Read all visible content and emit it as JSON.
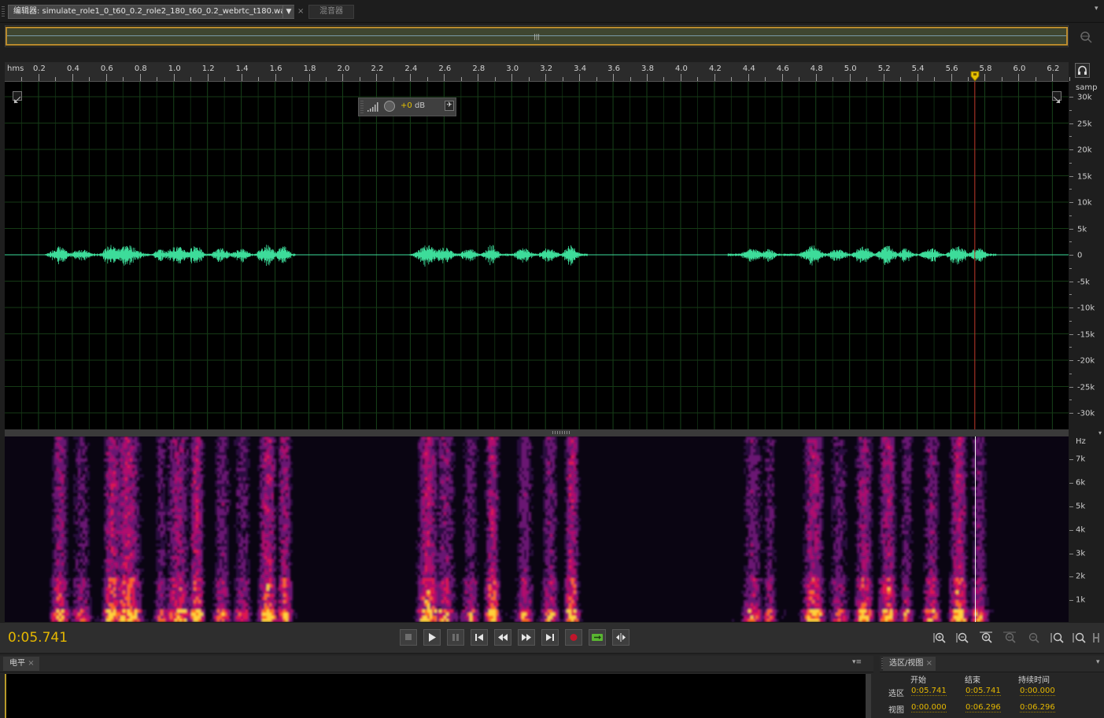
{
  "tabs": {
    "editor_label": "编辑器: simulate_role1_0_t60_0.2_role2_180_t60_0.2_webrtc_t180.wav",
    "dropdown_glyph": "▼",
    "close_glyph": "×",
    "mixer_label": "混音器",
    "menu_glyph": "▾≡"
  },
  "ruler": {
    "unit": "hms",
    "labels": [
      "0.2",
      "0.4",
      "0.6",
      "0.8",
      "1.0",
      "1.2",
      "1.4",
      "1.6",
      "1.8",
      "2.0",
      "2.2",
      "2.4",
      "2.6",
      "2.8",
      "3.0",
      "3.2",
      "3.4",
      "3.6",
      "3.8",
      "4.0",
      "4.2",
      "4.4",
      "4.6",
      "4.8",
      "5.0",
      "5.2",
      "5.4",
      "5.6",
      "5.8",
      "6.0",
      "6.2"
    ],
    "view_start_s": 0.0,
    "view_end_s": 6.296
  },
  "hud": {
    "gain_value": "+0",
    "gain_unit": "dB"
  },
  "amplitude_scale": {
    "unit": "samp",
    "labels": [
      "30k",
      "25k",
      "20k",
      "15k",
      "10k",
      "5k",
      "0",
      "-5k",
      "-10k",
      "-15k",
      "-20k",
      "-25k",
      "-30k"
    ]
  },
  "frequency_scale": {
    "unit": "Hz",
    "labels": [
      "7k",
      "6k",
      "5k",
      "4k",
      "3k",
      "2k",
      "1k"
    ]
  },
  "waveform": {
    "color": "#3ddc9a",
    "speech_segments_s": [
      [
        0.27,
        1.72
      ],
      [
        2.42,
        3.45
      ],
      [
        4.28,
        5.87
      ]
    ]
  },
  "playhead_s": 5.741,
  "transport": {
    "time": "0:05.741",
    "buttons": [
      "stop",
      "play",
      "pause",
      "go-to-start",
      "rewind",
      "fast-forward",
      "go-to-end",
      "record",
      "loop-playback",
      "skip-selection"
    ]
  },
  "levels_panel": {
    "tab_label": "电平",
    "close_glyph": "×"
  },
  "selection_panel": {
    "tab_label": "选区/视图",
    "close_glyph": "×",
    "headers": [
      "开始",
      "结束",
      "持续时间"
    ],
    "rows": [
      {
        "label": "选区",
        "start": "0:05.741",
        "end": "0:05.741",
        "duration": "0:00.000"
      },
      {
        "label": "视图",
        "start": "0:00.000",
        "end": "0:06.296",
        "duration": "0:06.296"
      }
    ]
  },
  "colors": {
    "accent": "#e6b800",
    "playhead_wave": "#c0392b",
    "grid": "#163a16"
  }
}
